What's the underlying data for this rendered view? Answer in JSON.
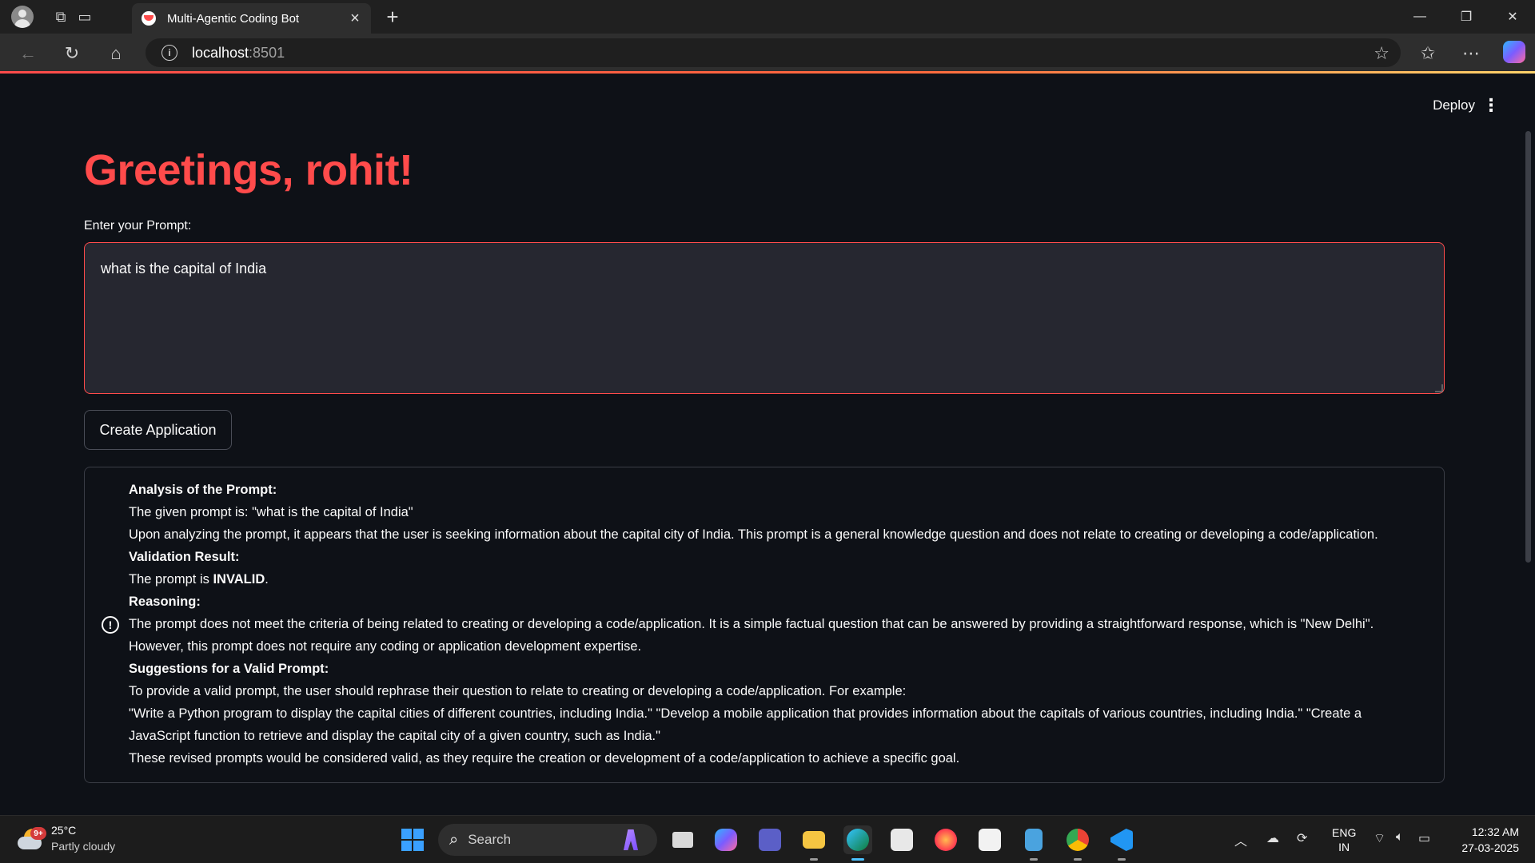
{
  "browser": {
    "tab_title": "Multi-Agentic Coding Bot",
    "url_host": "localhost",
    "url_port": ":8501"
  },
  "app": {
    "deploy_label": "Deploy",
    "greeting": "Greetings, rohit!",
    "prompt_label": "Enter your Prompt:",
    "prompt_value": "what is the capital of India",
    "create_button": "Create Application",
    "result": {
      "analysis_heading": "Analysis of the Prompt:",
      "given_prompt": "The given prompt is: \"what is the capital of India\"",
      "analysis_text": "Upon analyzing the prompt, it appears that the user is seeking information about the capital city of India. This prompt is a general knowledge question and does not relate to creating or developing a code/application.",
      "validation_heading": "Validation Result:",
      "validation_prefix": "The prompt is ",
      "validation_value": "INVALID",
      "validation_suffix": ".",
      "reasoning_heading": "Reasoning:",
      "reasoning_text": "The prompt does not meet the criteria of being related to creating or developing a code/application. It is a simple factual question that can be answered by providing a straightforward response, which is \"New Delhi\". However, this prompt does not require any coding or application development expertise.",
      "suggestions_heading": "Suggestions for a Valid Prompt:",
      "suggestions_intro": "To provide a valid prompt, the user should rephrase their question to relate to creating or developing a code/application. For example:",
      "suggestions_examples": "\"Write a Python program to display the capital cities of different countries, including India.\" \"Develop a mobile application that provides information about the capitals of various countries, including India.\" \"Create a JavaScript function to retrieve and display the capital city of a given country, such as India.\"",
      "conclusion": "These revised prompts would be considered valid, as they require the creation or development of a code/application to achieve a specific goal."
    }
  },
  "taskbar": {
    "weather_badge": "9+",
    "weather_temp": "25°C",
    "weather_desc": "Partly cloudy",
    "search_placeholder": "Search",
    "lang_top": "ENG",
    "lang_bottom": "IN",
    "time": "12:32 AM",
    "date": "27-03-2025"
  },
  "colors": {
    "accent": "#ff4b4b",
    "background": "#0e1117",
    "input_bg": "#262730"
  }
}
